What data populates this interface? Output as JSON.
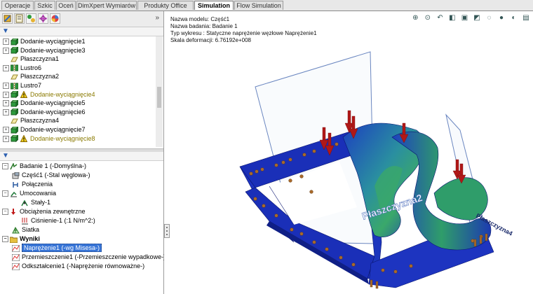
{
  "tabs": [
    {
      "label": "Operacje",
      "active": false
    },
    {
      "label": "Szkic",
      "active": false
    },
    {
      "label": "Oceń",
      "active": false
    },
    {
      "label": "DimXpert Wymiarów",
      "active": false
    },
    {
      "label": "Produkty Office",
      "active": false
    },
    {
      "label": "Simulation",
      "active": true
    },
    {
      "label": "Flow Simulation",
      "active": false
    }
  ],
  "feature_tree": {
    "items": [
      {
        "label": "Dodanie-wyciągnięcie1",
        "icon": "extrude-icon",
        "warning": false
      },
      {
        "label": "Dodanie-wyciągnięcie3",
        "icon": "extrude-icon",
        "warning": false
      },
      {
        "label": "Płaszczyzna1",
        "icon": "plane-icon",
        "warning": false
      },
      {
        "label": "Lustro6",
        "icon": "mirror-icon",
        "warning": false
      },
      {
        "label": "Płaszczyzna2",
        "icon": "plane-icon",
        "warning": false
      },
      {
        "label": "Lustro7",
        "icon": "mirror-icon",
        "warning": false
      },
      {
        "label": "Dodanie-wyciągnięcie4",
        "icon": "extrude-icon",
        "warning": true
      },
      {
        "label": "Dodanie-wyciągnięcie5",
        "icon": "extrude-icon",
        "warning": false
      },
      {
        "label": "Dodanie-wyciągnięcie6",
        "icon": "extrude-icon",
        "warning": false
      },
      {
        "label": "Płaszczyzna4",
        "icon": "plane-icon",
        "warning": false
      },
      {
        "label": "Dodanie-wyciągnięcie7",
        "icon": "extrude-icon",
        "warning": false
      },
      {
        "label": "Dodanie-wyciągnięcie8",
        "icon": "extrude-icon",
        "warning": true
      }
    ]
  },
  "study_tree": {
    "study": "Badanie 1 (-Domyślna-)",
    "part": "Część1 (-Stal węglowa-)",
    "connections": "Połączenia",
    "fixtures": "Umocowania",
    "fixture1": "Stały-1",
    "loads": "Obciążenia zewnętrzne",
    "load1": "Ciśnienie-1 (:1 N/m^2:)",
    "mesh": "Siatka",
    "results": "Wyniki",
    "result1": "Naprężenie1 (-wg Misesa-)",
    "result2": "Przemieszczenie1 (-Przemieszczenie wypadkowe-)",
    "result3": "Odkształcenie1 (-Naprężenie równoważne-)"
  },
  "plot_info": {
    "model_name": "Nazwa modelu: Część1",
    "study_name": "Nazwa badania: Badanie 1",
    "plot_type": "Typ wykresu : Statyczne naprężenie węzłowe Naprężenie1",
    "deform_scale": "Skala deformacji: 6.76192e+008"
  },
  "viewport_labels": {
    "plane_label_1": "Płaszczyzna2",
    "plane_label_2": "Płaszczyzna4"
  },
  "colors": {
    "accent_selection": "#3875d7",
    "mesh_blue": "#1a2fb8",
    "stress_green": "#2f9d6a",
    "load_arrow": "#b01818",
    "fixture": "#b0702a"
  }
}
